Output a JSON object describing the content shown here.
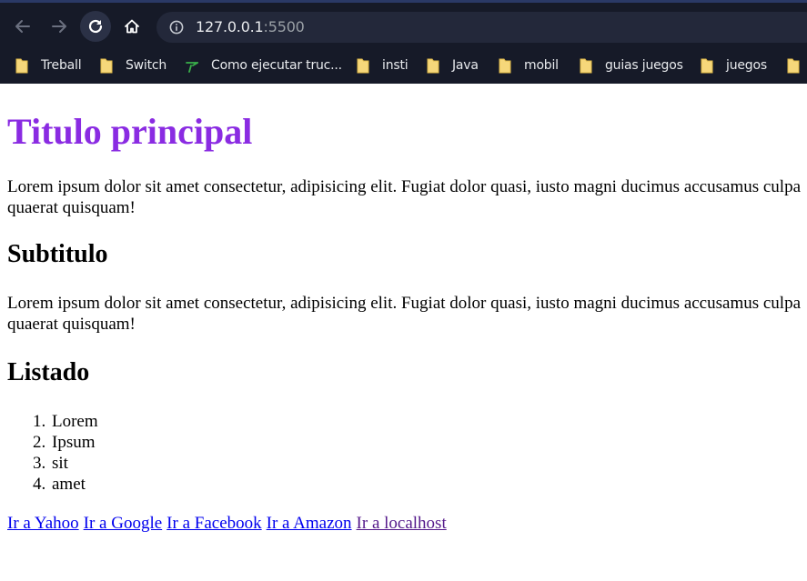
{
  "browser": {
    "url_host": "127.0.0.1",
    "url_port": ":5500",
    "icons": {
      "back": "arrow-left-icon",
      "forward": "arrow-right-icon",
      "reload": "reload-icon",
      "home": "home-icon",
      "site_info": "info-icon"
    },
    "bookmarks": [
      {
        "label": "Treball",
        "icon": "folder-icon"
      },
      {
        "label": "Switch",
        "icon": "folder-icon"
      },
      {
        "label": "Como ejecutar truc...",
        "icon": "site-favicon"
      },
      {
        "label": "insti",
        "icon": "folder-icon"
      },
      {
        "label": "Java",
        "icon": "folder-icon"
      },
      {
        "label": "mobil",
        "icon": "folder-icon"
      },
      {
        "label": "guias juegos",
        "icon": "folder-icon"
      },
      {
        "label": "juegos",
        "icon": "folder-icon"
      }
    ]
  },
  "page": {
    "title": "Titulo principal",
    "paragraph1": {
      "line1": "Lorem ipsum dolor sit amet consectetur, adipisicing elit. Fugiat dolor quasi, iusto magni ducimus accusamus culpa",
      "line2": "quaerat quisquam!"
    },
    "subtitle1": "Subtitulo",
    "paragraph2": {
      "line1": "Lorem ipsum dolor sit amet consectetur, adipisicing elit. Fugiat dolor quasi, iusto magni ducimus accusamus culpa",
      "line2": "quaerat quisquam!"
    },
    "subtitle2": "Listado",
    "list": [
      {
        "num": "1.",
        "text": "Lorem"
      },
      {
        "num": "2.",
        "text": "Ipsum"
      },
      {
        "num": "3.",
        "text": "sit"
      },
      {
        "num": "4.",
        "text": "amet"
      }
    ],
    "links": [
      {
        "label": "Ir a Yahoo",
        "visited": false
      },
      {
        "label": "Ir a Google",
        "visited": false
      },
      {
        "label": "Ir a Facebook",
        "visited": false
      },
      {
        "label": "Ir a Amazon",
        "visited": false
      },
      {
        "label": "Ir a localhost",
        "visited": true
      }
    ]
  },
  "colors": {
    "title": "#8a2be2",
    "link": "#0000ee",
    "visited_link": "#551a8b",
    "chrome_bg": "#161a28"
  }
}
